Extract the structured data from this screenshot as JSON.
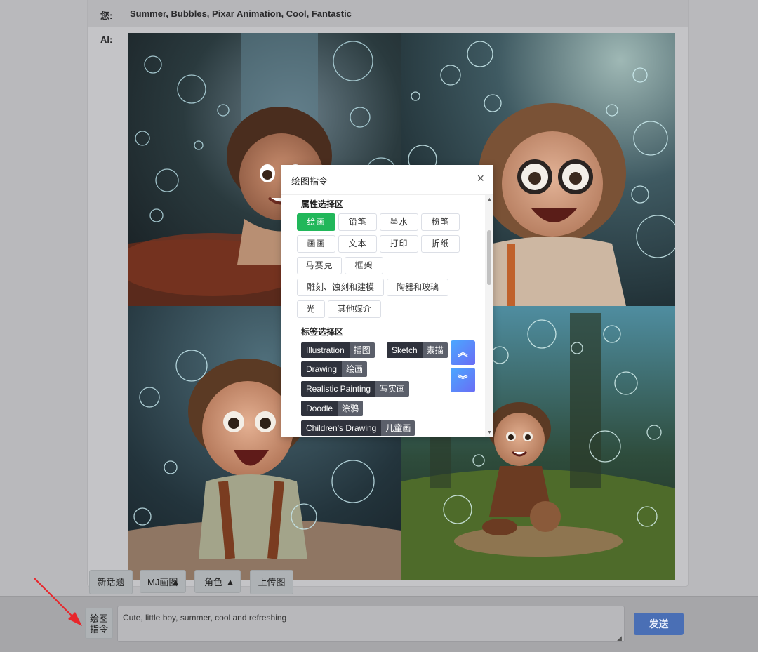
{
  "chat": {
    "user_label": "您:",
    "user_message": "Summer, Bubbles, Pixar Animation, Cool, Fantastic",
    "ai_label": "AI:"
  },
  "toolbar": {
    "new_topic": "新话题",
    "mj_drawing": "MJ画图",
    "role": "角色",
    "upload_image": "上传图",
    "triangle": "▲"
  },
  "input": {
    "command_button": "绘图指令",
    "prompt_value": "Cute, little boy, summer, cool and refreshing",
    "send": "发送"
  },
  "modal": {
    "title": "绘图指令",
    "close": "×",
    "attr_section": "属性选择区",
    "attributes": [
      "绘画",
      "铅笔",
      "墨水",
      "粉笔",
      "画画",
      "文本",
      "打印",
      "折纸",
      "马赛克",
      "框架",
      "雕刻、蚀刻和建模",
      "陶器和玻璃",
      "光",
      "其他媒介"
    ],
    "tag_section": "标签选择区",
    "tags": [
      {
        "en": "Illustration",
        "zh": "插图"
      },
      {
        "en": "Sketch",
        "zh": "素描"
      },
      {
        "en": "Drawing",
        "zh": "绘画"
      },
      {
        "en": "Realistic Painting",
        "zh": "写实画"
      },
      {
        "en": "Doodle",
        "zh": "涂鸦"
      },
      {
        "en": "Children's Drawing",
        "zh": "儿童画"
      }
    ],
    "scroll_top": "︽",
    "scroll_bottom": "︾"
  },
  "colors": {
    "active_chip": "#21b75a",
    "send_button": "#4a6fb5",
    "tag_dark": "#2f323c",
    "nav_gradient_start": "#4aa8ff",
    "nav_gradient_end": "#6a6cf5"
  }
}
